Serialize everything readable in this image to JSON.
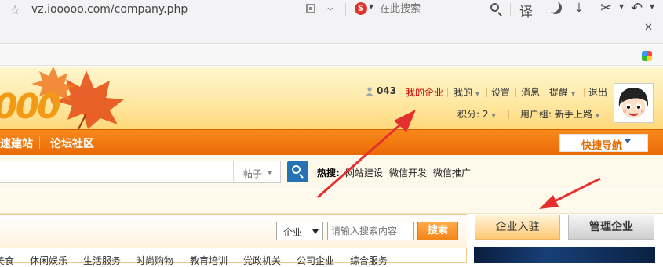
{
  "browser": {
    "url": "vz.iooooo.com/company.php",
    "search_placeholder": "在此搜索",
    "search_engine_logo": "S",
    "translate_label": "译"
  },
  "site": {
    "logo_text": "000",
    "user_id": "043",
    "top_links": [
      "我的企业",
      "我的",
      "设置",
      "消息",
      "提醒",
      "退出"
    ],
    "points": "积分: 2",
    "user_group": "用户组: 新手上路",
    "nav": [
      "速建站",
      "论坛社区"
    ],
    "quick_nav": "快捷导航",
    "search_type": "帖子",
    "hot_label": "热搜:",
    "hot_terms": [
      "网站建设",
      "微信开发",
      "微信推广"
    ],
    "company": {
      "category_selected": "企业",
      "keyword_placeholder": "请输入搜索内容",
      "search_button": "搜索",
      "categories": [
        "美食",
        "休闲娱乐",
        "生活服务",
        "时尚购物",
        "教育培训",
        "党政机关",
        "公司企业",
        "综合服务"
      ]
    },
    "enter_button": "企业入驻",
    "manage_button": "管理企业"
  },
  "colors": {
    "nav_orange": "#f07a12",
    "link_red": "#cc0000",
    "annotation_arrow": "#e53030",
    "search_blue": "#2473b4"
  }
}
